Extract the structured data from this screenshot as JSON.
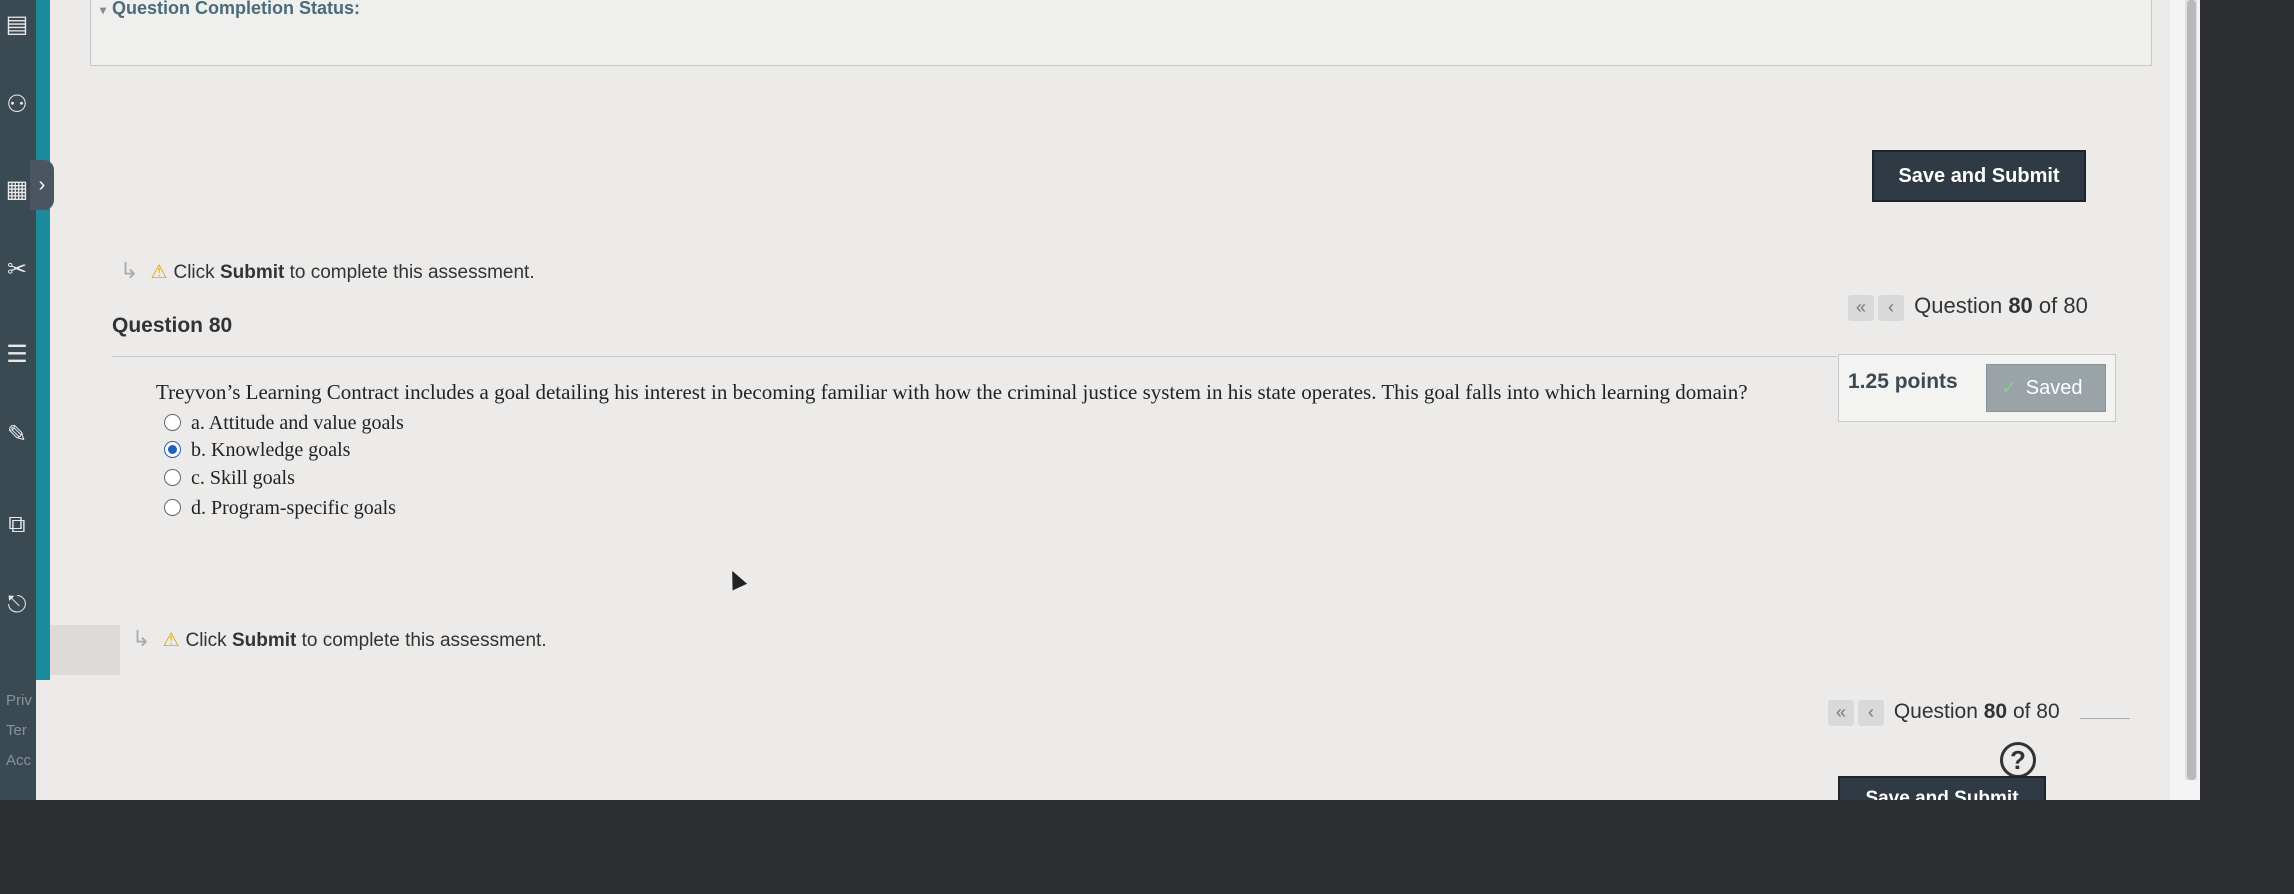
{
  "status_panel": {
    "title": "Question Completion Status:"
  },
  "actions": {
    "save_submit_label": "Save and Submit"
  },
  "notice": {
    "prefix": "Click",
    "bold": "Submit",
    "suffix": "to complete this assessment."
  },
  "question": {
    "title": "Question 80",
    "points": "1.25 points",
    "saved_label": "Saved",
    "text": "Treyvon’s Learning Contract includes a goal detailing his interest in becoming familiar with how the criminal justice system in his state operates. This goal falls into which learning domain?",
    "options": [
      {
        "label": "a. Attitude and value goals",
        "selected": false
      },
      {
        "label": "b. Knowledge goals",
        "selected": true
      },
      {
        "label": "c. Skill goals",
        "selected": false
      },
      {
        "label": "d. Program-specific goals",
        "selected": false
      }
    ]
  },
  "navigation": {
    "prefix": "Question",
    "current": "80",
    "of_label": "of 80"
  },
  "left_footer": {
    "items": [
      "Priv",
      "Ter",
      "Acc"
    ]
  },
  "colors": {
    "sidebar_blue": "#1b8a9c",
    "button_dark": "#2f3a44",
    "saved_badge": "#9aa4a8",
    "selected_radio": "#1f5fbf",
    "warning": "#e6a600"
  }
}
